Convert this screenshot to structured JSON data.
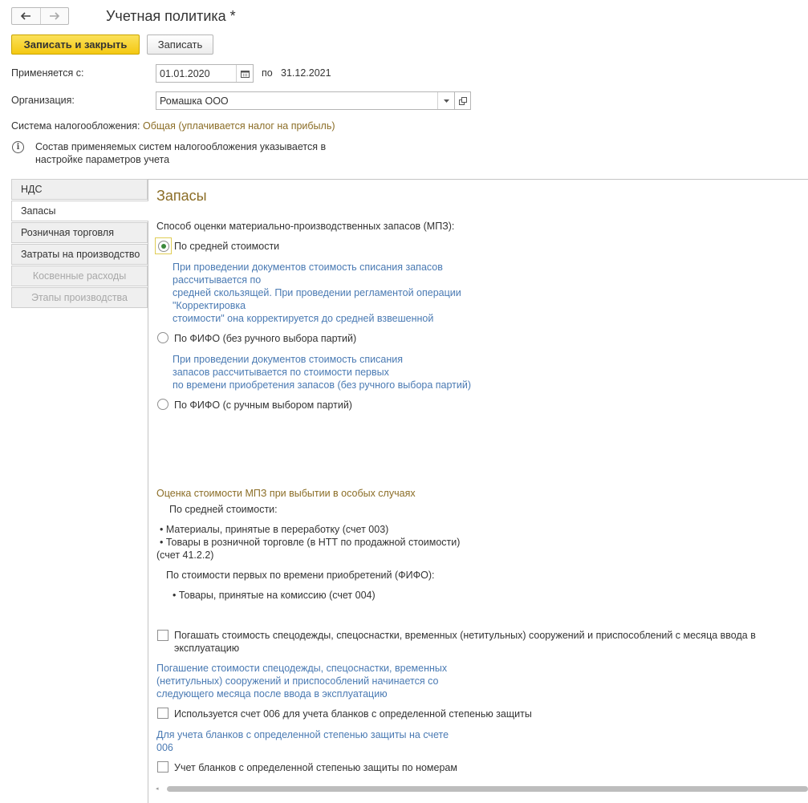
{
  "window": {
    "title": "Учетная политика *"
  },
  "toolbar": {
    "save_close_label": "Записать и закрыть",
    "save_label": "Записать"
  },
  "period": {
    "label": "Применяется с:",
    "start_value": "01.01.2020",
    "to_label": "по",
    "end_value": "31.12.2021"
  },
  "organization": {
    "label": "Организация:",
    "value": "Ромашка ООО"
  },
  "tax_system": {
    "label": "Система налогообложения:",
    "value": "Общая (уплачивается налог на прибыль)"
  },
  "info_note": {
    "lines": [
      "Состав применяемых систем налогообложения указывается в",
      "настройке параметров учета"
    ]
  },
  "tabs": [
    {
      "label": "НДС",
      "state": "normal"
    },
    {
      "label": "Запасы",
      "state": "active"
    },
    {
      "label": "Розничная торговля",
      "state": "normal"
    },
    {
      "label": "Затраты на производство",
      "state": "normal"
    },
    {
      "label": "Косвенные расходы",
      "state": "disabled"
    },
    {
      "label": "Этапы производства",
      "state": "disabled"
    }
  ],
  "content": {
    "title": "Запасы",
    "method_label": "Способ оценки материально-производственных запасов (МПЗ):",
    "options": [
      {
        "label": "По средней стоимости",
        "selected": true,
        "hint_lines": [
          "При проведении документов стоимость списания запасов",
          "рассчитывается по",
          "средней скользящей. При проведении регламентой операции",
          "\"Корректировка",
          "стоимости\" она корректируется до средней взвешенной"
        ]
      },
      {
        "label": "По ФИФО (без ручного выбора партий)",
        "selected": false,
        "hint_lines": [
          "При проведении документов стоимость списания",
          "запасов рассчитывается по стоимости первых",
          "по времени приобретения запасов (без ручного выбора партий)"
        ]
      },
      {
        "label": "По ФИФО (с ручным выбором партий)",
        "selected": false
      }
    ],
    "special": {
      "title": "Оценка стоимости МПЗ при выбытии в  особых случаях",
      "avg_label": "По средней стоимости:",
      "avg_items": [
        "• Материалы, принятые в переработку (счет 003)",
        "• Товары в розничной торговле (в НТТ по продажной стоимости)",
        "(счет 41.2.2)"
      ],
      "fifo_label": "По стоимости первых по времени приобретений (ФИФО):",
      "fifo_items": [
        "• Товары, принятые на комиссию (счет 004)"
      ]
    },
    "checks": [
      {
        "lines": [
          "Погашать стоимость спецодежды, спецоснастки,  временных (нетитульных) сооружений и приспособлений с месяца ввода в",
          "эксплуатацию"
        ],
        "checked": false,
        "hint_lines": [
          "Погашение стоимости спецодежды, спецоснастки, временных",
          "(нетитульных) сооружений и приспособлений начинается со",
          "следующего месяца после ввода в эксплуатацию"
        ]
      },
      {
        "lines": [
          "Используется счет 006 для учета бланков с определенной степенью защиты"
        ],
        "checked": false,
        "hint_lines": [
          "Для учета бланков с определенной степенью защиты на счете",
          "006"
        ]
      },
      {
        "lines": [
          "Учет бланков с определенной степенью защиты по номерам"
        ],
        "checked": false
      }
    ]
  },
  "icons": {
    "back": "arrow-left-icon",
    "forward": "arrow-right-icon",
    "calendar": "calendar-icon",
    "dropdown": "chevron-down-icon",
    "open": "open-form-icon",
    "info": "info-icon"
  },
  "colors": {
    "primary_button": "#f4c812",
    "section_title": "#8b6d26",
    "hint_text": "#4a7ab3",
    "radio_dot": "#3b8a3b"
  }
}
